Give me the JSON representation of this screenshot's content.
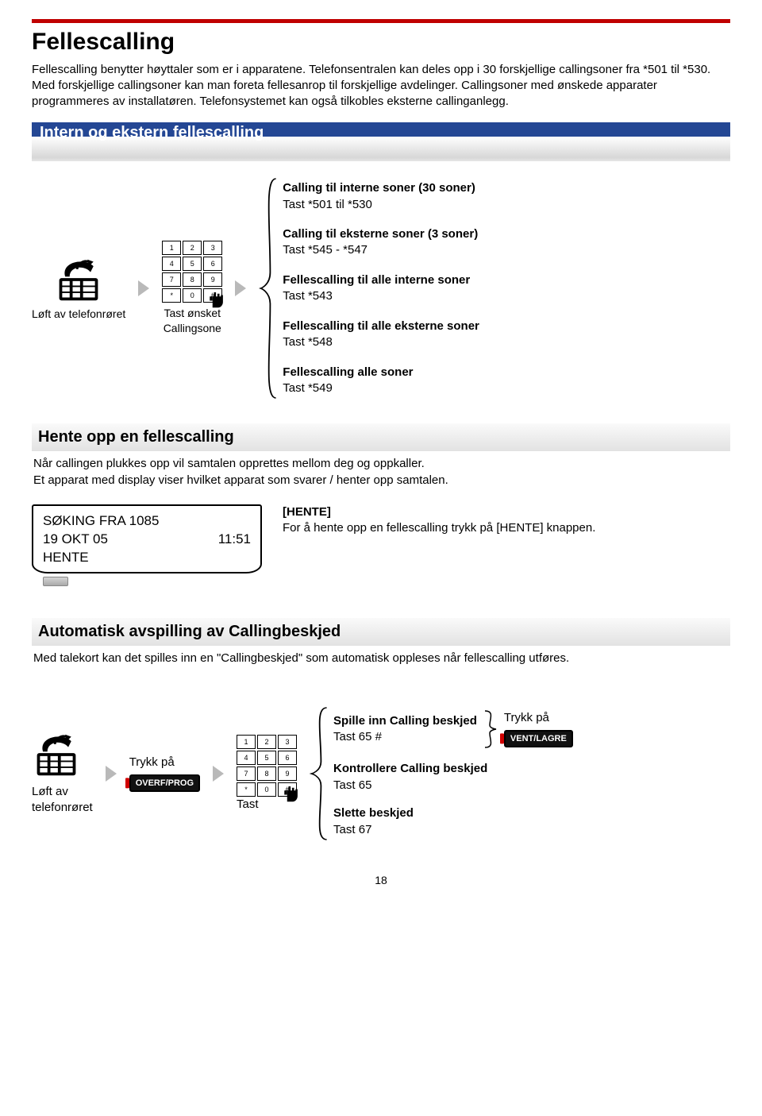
{
  "page_title": "Fellescalling",
  "intro": "Fellescalling benytter høyttaler som er i apparatene. Telefonsentralen kan deles opp i 30 forskjellige callingsoner fra *501 til *530. Med forskjellige callingsoner kan man foreta fellesanrop til forskjellige avdelinger. Callingsoner med ønskede apparater programmeres av installatøren. Telefonsystemet kan også tilkobles eksterne callinganlegg.",
  "section1": {
    "title": "Intern og ekstern fellescalling",
    "lift_label": "Løft av telefonrøret",
    "keypad_label_line1": "Tast ønsket",
    "keypad_label_line2": "Callingsone",
    "options": [
      {
        "title": "Calling til interne soner (30 soner)",
        "code": "Tast *501 til *530"
      },
      {
        "title": "Calling til eksterne soner (3 soner)",
        "code": "Tast *545 - *547"
      },
      {
        "title": "Fellescalling til alle interne soner",
        "code": "Tast *543"
      },
      {
        "title": "Fellescalling til alle eksterne soner",
        "code": "Tast *548"
      },
      {
        "title": "Fellescalling alle soner",
        "code": "Tast *549"
      }
    ]
  },
  "section2": {
    "title": "Hente opp en fellescalling",
    "desc": "Når callingen plukkes opp vil samtalen opprettes mellom deg og oppkaller.\nEt apparat med display viser hvilket apparat som svarer / henter opp samtalen.",
    "display": {
      "line1": "SØKING FRA 1085",
      "line2_left": "19 OKT 05",
      "line2_right": "11:51",
      "line3": "HENTE"
    },
    "hente_label": "[HENTE]",
    "hente_desc": "For å hente opp en fellescalling trykk på [HENTE] knappen."
  },
  "section3": {
    "title": "Automatisk avspilling av Callingbeskjed",
    "desc": "Med talekort kan det spilles inn en \"Callingbeskjed\" som automatisk oppleses når fellescalling utføres.",
    "press_label": "Trykk på",
    "overf_btn": "OVERF/PROG",
    "lift_label_line1": "Løft av",
    "lift_label_line2": "telefonrøret",
    "tast_label": "Tast",
    "options": [
      {
        "title": "Spille inn Calling beskjed",
        "code": "Tast 65 #"
      },
      {
        "title": "Kontrollere Calling beskjed",
        "code": "Tast 65"
      },
      {
        "title": "Slette beskjed",
        "code": "Tast 67"
      }
    ],
    "vent_press": "Trykk på",
    "vent_btn": "VENT/LAGRE"
  },
  "keypad_keys": [
    "1",
    "2",
    "3",
    "4",
    "5",
    "6",
    "7",
    "8",
    "9",
    "*",
    "0",
    "#"
  ],
  "page_number": "18"
}
